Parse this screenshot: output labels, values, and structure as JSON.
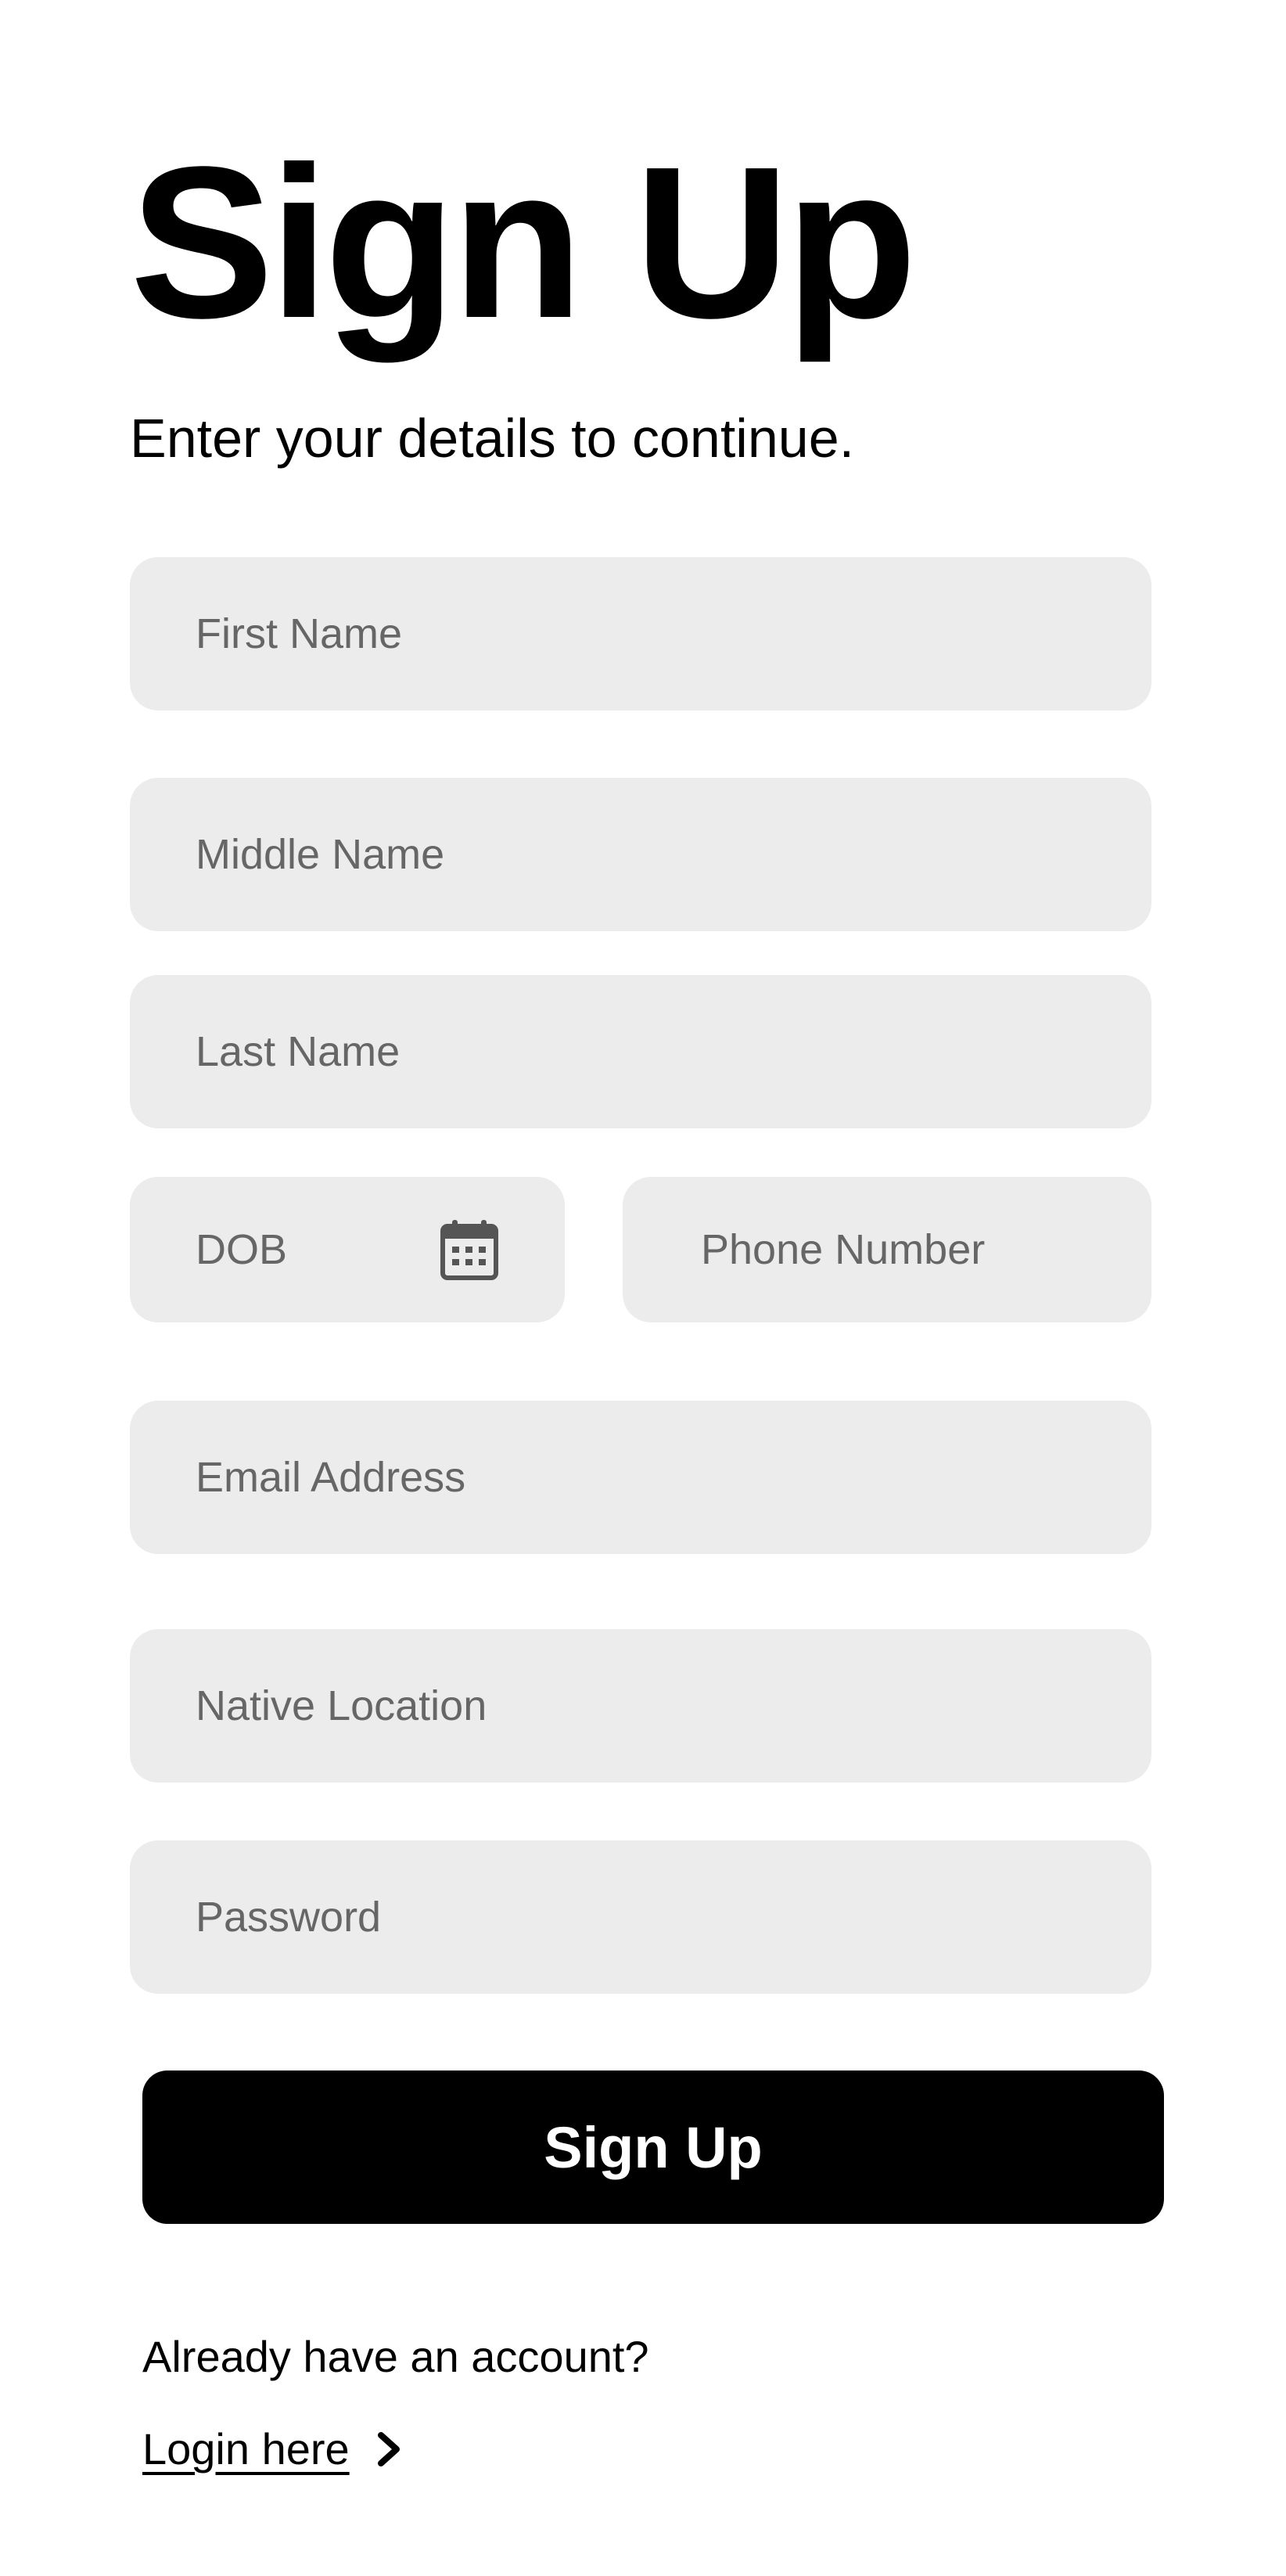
{
  "header": {
    "title": "Sign Up",
    "subtitle": "Enter your details to continue."
  },
  "form": {
    "first_name": {
      "placeholder": "First Name",
      "value": ""
    },
    "middle_name": {
      "placeholder": "Middle Name",
      "value": ""
    },
    "last_name": {
      "placeholder": "Last Name",
      "value": ""
    },
    "dob": {
      "placeholder": "DOB",
      "value": "",
      "icon": "calendar-icon"
    },
    "phone": {
      "placeholder": "Phone Number",
      "value": ""
    },
    "email": {
      "placeholder": "Email Address",
      "value": ""
    },
    "native_location": {
      "placeholder": "Native Location",
      "value": ""
    },
    "password": {
      "placeholder": "Password",
      "value": ""
    },
    "submit_label": "Sign Up"
  },
  "footer": {
    "account_prompt": "Already have an account?",
    "login_label": "Login here",
    "login_icon": "chevron-right-icon"
  },
  "colors": {
    "background": "#ffffff",
    "field_background": "#ececec",
    "placeholder": "#666666",
    "primary_button": "#000000",
    "primary_button_text": "#ffffff",
    "text": "#000000"
  }
}
